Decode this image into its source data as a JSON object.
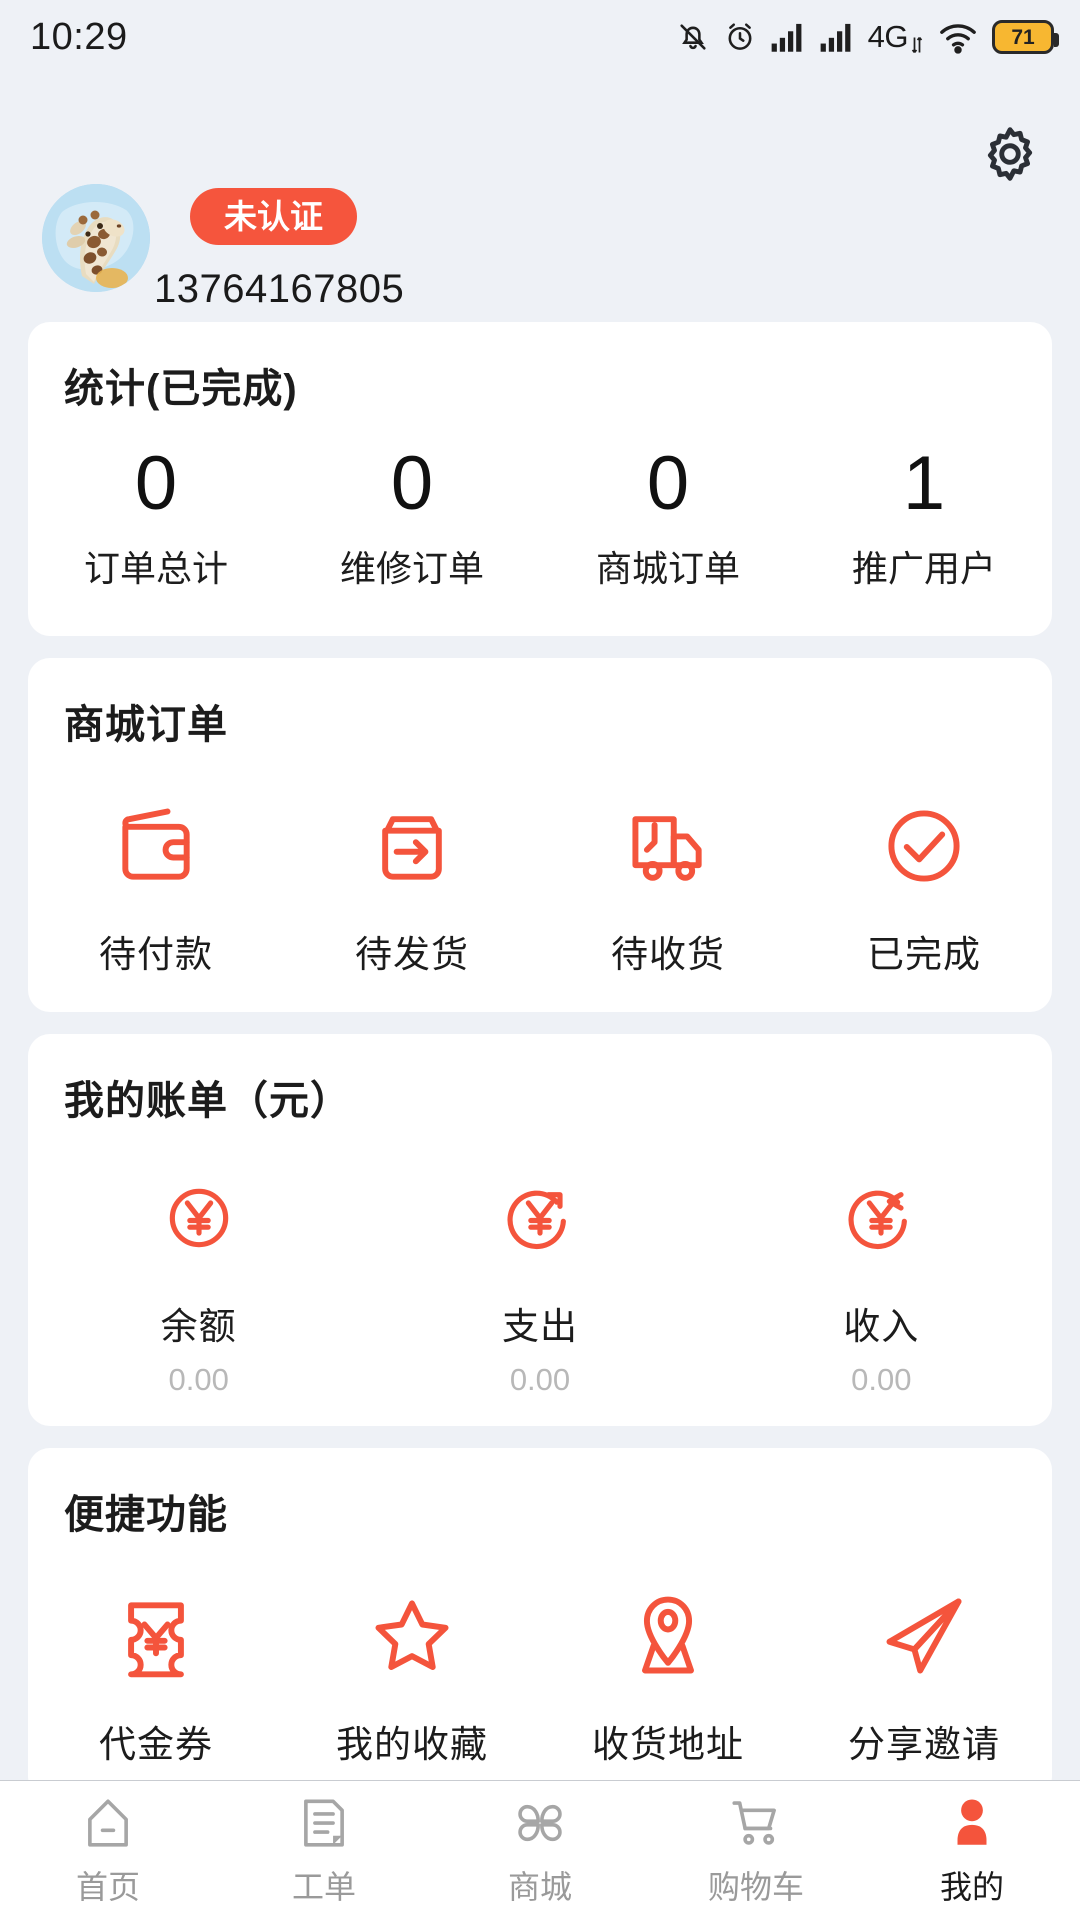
{
  "statusbar": {
    "time": "10:29",
    "network_label": "4G",
    "battery_level": "71",
    "icons": [
      "bell-mute-icon",
      "alarm-icon",
      "signal-icon",
      "signal-icon",
      "network-4g-label",
      "wifi-icon",
      "battery-icon"
    ]
  },
  "header": {
    "settings_icon": "gear-icon",
    "avatar_icon": "giraffe-avatar",
    "verify_badge": "未认证",
    "phone": "13764167805"
  },
  "stats_card": {
    "title": "统计(已完成)",
    "items": [
      {
        "value": "0",
        "label": "订单总计"
      },
      {
        "value": "0",
        "label": "维修订单"
      },
      {
        "value": "0",
        "label": "商城订单"
      },
      {
        "value": "1",
        "label": "推广用户"
      }
    ]
  },
  "mall_card": {
    "title": "商城订单",
    "items": [
      {
        "icon": "wallet-icon",
        "label": "待付款"
      },
      {
        "icon": "shipping-box-arrow-icon",
        "label": "待发货"
      },
      {
        "icon": "truck-icon",
        "label": "待收货"
      },
      {
        "icon": "check-circle-icon",
        "label": "已完成"
      }
    ]
  },
  "bill_card": {
    "title": "我的账单（元）",
    "items": [
      {
        "icon": "yuan-circle-icon",
        "label": "余额",
        "value": "0.00"
      },
      {
        "icon": "yuan-arrow-out-icon",
        "label": "支出",
        "value": "0.00"
      },
      {
        "icon": "yuan-arrow-in-icon",
        "label": "收入",
        "value": "0.00"
      }
    ]
  },
  "function_card": {
    "title": "便捷功能",
    "items": [
      {
        "icon": "coupon-icon",
        "label": "代金券"
      },
      {
        "icon": "star-icon",
        "label": "我的收藏"
      },
      {
        "icon": "location-pin-icon",
        "label": "收货地址"
      },
      {
        "icon": "paper-plane-icon",
        "label": "分享邀请"
      }
    ]
  },
  "tabbar": {
    "items": [
      {
        "icon": "home-icon",
        "label": "首页",
        "active": false
      },
      {
        "icon": "work-order-icon",
        "label": "工单",
        "active": false
      },
      {
        "icon": "mall-grid-icon",
        "label": "商城",
        "active": false
      },
      {
        "icon": "cart-icon",
        "label": "购物车",
        "active": false
      },
      {
        "icon": "user-icon",
        "label": "我的",
        "active": true
      }
    ]
  },
  "colors": {
    "accent": "#f5553d",
    "page_bg": "#eef1f6",
    "card_bg": "#ffffff",
    "muted_text": "#b8b8b8",
    "battery": "#f7b731"
  }
}
